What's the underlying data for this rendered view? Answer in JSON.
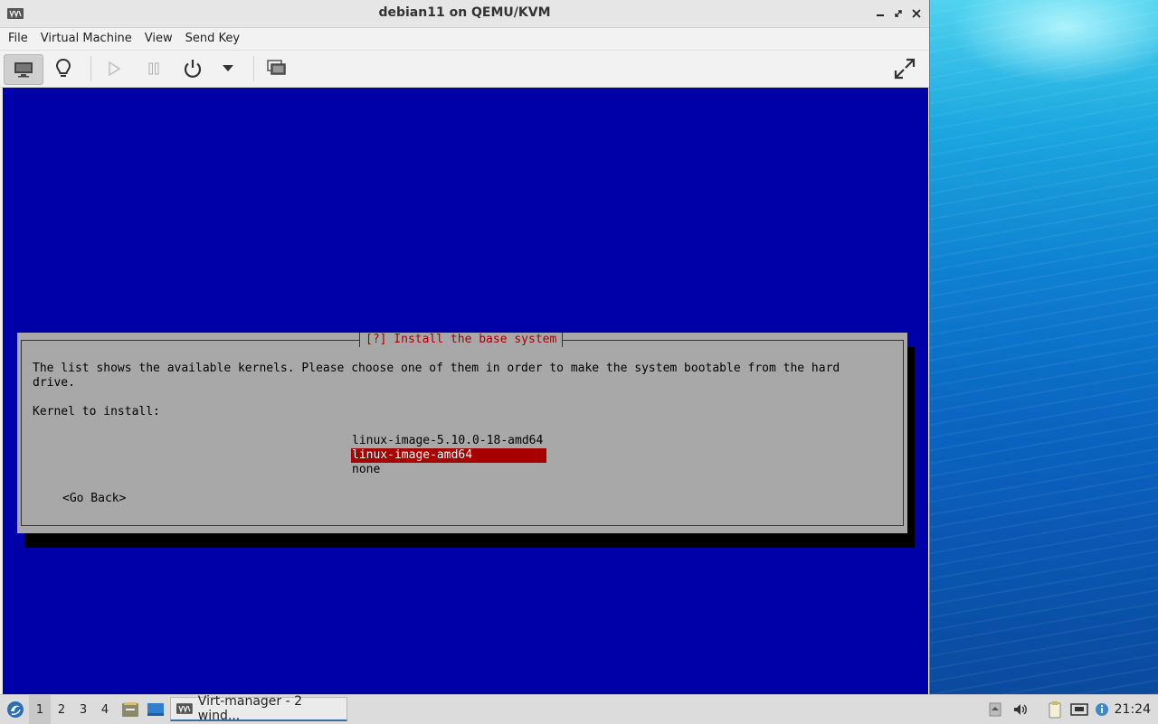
{
  "window": {
    "title": "debian11 on QEMU/KVM"
  },
  "menubar": {
    "items": [
      "File",
      "Virtual Machine",
      "View",
      "Send Key"
    ]
  },
  "toolbar": {
    "buttons": [
      "monitor-icon",
      "lightbulb-icon",
      "play-icon",
      "pause-icon",
      "power-icon",
      "chevron-down-icon",
      "snapshots-icon",
      "fullscreen-icon"
    ]
  },
  "installer": {
    "dialog_title": "[?] Install the base system",
    "description": "The list shows the available kernels. Please choose one of them in order to make the system bootable from the hard\ndrive.",
    "kernel_label": "Kernel to install:",
    "kernels": [
      "linux-image-5.10.0-18-amd64",
      "linux-image-amd64",
      "none"
    ],
    "selected_index": 1,
    "go_back": "<Go Back>"
  },
  "taskbar": {
    "workspaces": [
      "1",
      "2",
      "3",
      "4"
    ],
    "active_workspace": "1",
    "task_label": "Virt-manager - 2 wind...",
    "clock": "21:24"
  },
  "colors": {
    "guest_background": "#0000a8",
    "dialog_background": "#a8a8a8",
    "title_red": "#a80000",
    "selection": "#a80000"
  }
}
